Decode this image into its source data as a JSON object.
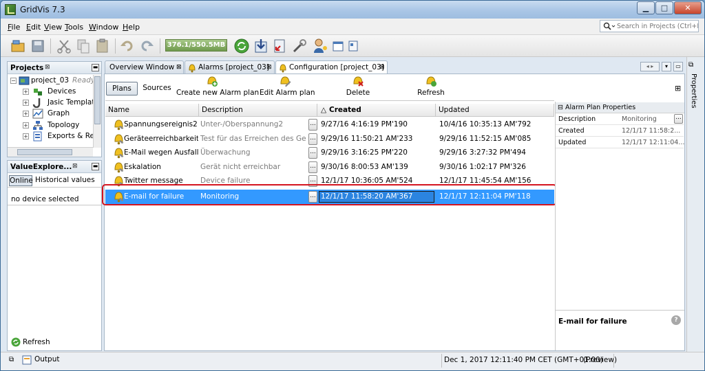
{
  "window": {
    "title": "GridVis 7.3",
    "min": "▁",
    "max": "□",
    "close": "✕"
  },
  "menu": [
    {
      "mnemonic": "F",
      "rest": "ile"
    },
    {
      "mnemonic": "E",
      "rest": "dit"
    },
    {
      "mnemonic": "V",
      "rest": "iew"
    },
    {
      "mnemonic": "T",
      "rest": "ools"
    },
    {
      "mnemonic": "W",
      "rest": "indow"
    },
    {
      "mnemonic": "H",
      "rest": "elp"
    }
  ],
  "search": {
    "placeholder": "Search in Projects (Ctrl+I)"
  },
  "toolbar": {
    "memory": "376.1/550.5MB"
  },
  "projects": {
    "title": "Projects",
    "close": "⊠",
    "root": {
      "label": "project_03",
      "status": "Ready"
    },
    "children": [
      "Devices",
      "Jasic Templates",
      "Graph",
      "Topology",
      "Exports & Reports"
    ]
  },
  "value_explorer": {
    "title": "ValueExplore...",
    "close": "⊠",
    "tabs": [
      "Online",
      "Historical values"
    ],
    "empty": "no device selected",
    "refresh": "Refresh"
  },
  "output": "Output",
  "tabs": [
    {
      "label": "Overview Window",
      "close": "⊠"
    },
    {
      "label": "Alarms [project_03]",
      "close": "⊠"
    },
    {
      "label": "Configuration [project_03]",
      "close": "⊠"
    }
  ],
  "subtabs": [
    "Plans",
    "Sources"
  ],
  "actions": [
    "Create new Alarm plan",
    "Edit Alarm plan",
    "Delete",
    "Refresh"
  ],
  "table": {
    "columns": [
      "Name",
      "Description",
      "Created",
      "Updated"
    ],
    "sort_indicator": "△",
    "rows": [
      {
        "name": "Spannungsereignis2",
        "description": "Unter-/Oberspannung2",
        "created": "9/27/16 4:16:19 PM'190",
        "updated": "10/4/16 10:35:13 AM'792"
      },
      {
        "name": "Geräteerreichbarkeit33",
        "description": "Test für das Erreichen des Gerä...",
        "created": "9/29/16 11:50:21 AM'233",
        "updated": "9/29/16 11:52:15 AM'085"
      },
      {
        "name": "E-Mail wegen Ausfall",
        "description": "Überwachung",
        "created": "9/29/16 3:16:25 PM'220",
        "updated": "9/29/16 3:27:32 PM'494"
      },
      {
        "name": "Eskalation",
        "description": "Gerät nicht erreichbar",
        "created": "9/30/16 8:00:53 AM'139",
        "updated": "9/30/16 1:02:17 PM'326"
      },
      {
        "name": "Twitter message",
        "description": "Device failure",
        "created": "12/1/17 10:36:05 AM'524",
        "updated": "12/1/17 11:45:54 AM'156"
      },
      {
        "name": "E-mail for failure",
        "description": "Monitoring",
        "created": "12/1/17 11:58:20 AM'367",
        "updated": "12/1/17 12:11:04 PM'118"
      }
    ],
    "ellipsis": "..."
  },
  "properties": {
    "header": "Alarm Plan Properties",
    "rows": [
      {
        "key": "Description",
        "value": "Monitoring"
      },
      {
        "key": "Created",
        "value": "12/1/17 11:58:2..."
      },
      {
        "key": "Updated",
        "value": "12/1/17 12:11:04..."
      }
    ],
    "footer_title": "E-mail for failure",
    "side_label": "Properties",
    "help": "?"
  },
  "status": {
    "datetime": "Dec 1, 2017 12:11:40 PM CET (GMT+01:00)",
    "mode": "(Preview)"
  },
  "colors": {
    "selection": "#3399ff",
    "highlight_border": "#d4141e"
  }
}
